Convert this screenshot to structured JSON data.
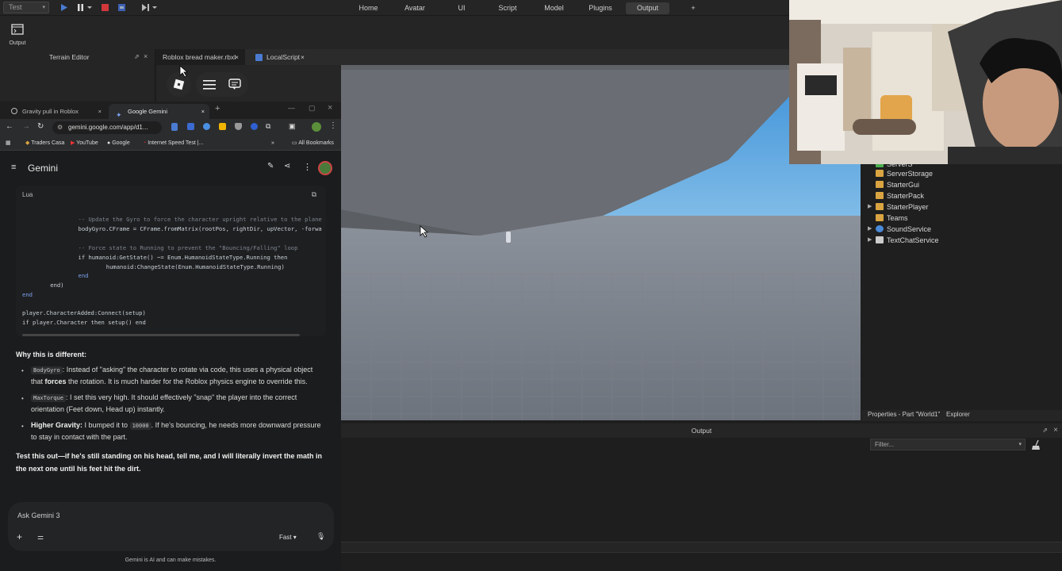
{
  "studio": {
    "mode": "Test",
    "menu_tabs": [
      "Home",
      "Avatar",
      "UI",
      "Script",
      "Model",
      "Plugins",
      "Output",
      "+"
    ],
    "active_tab": "Output",
    "output_tool_label": "Output",
    "terrain_editor": "Terrain Editor",
    "doc_tabs": [
      "Roblox bread maker.rbxl",
      "LocalScript"
    ],
    "explorer_items": [
      {
        "label": "ServerS",
        "icon_color": "#4caf50",
        "arrow": false
      },
      {
        "label": "ServerStorage",
        "icon_color": "#d9a441",
        "arrow": false
      },
      {
        "label": "StarterGui",
        "icon_color": "#d9a441",
        "arrow": false
      },
      {
        "label": "StarterPack",
        "icon_color": "#d9a441",
        "arrow": false
      },
      {
        "label": "StarterPlayer",
        "icon_color": "#d9a441",
        "arrow": true
      },
      {
        "label": "Teams",
        "icon_color": "#d9a441",
        "arrow": false
      },
      {
        "label": "SoundService",
        "icon_color": "#4a8ad8",
        "arrow": true
      },
      {
        "label": "TextChatService",
        "icon_color": "#cccccc",
        "arrow": true
      }
    ],
    "footer_tabs": [
      "Properties - Part \"World1\"",
      "Explorer"
    ],
    "output_title": "Output",
    "filter_placeholder": "Filter..."
  },
  "browser": {
    "tabs": [
      "Gravity pull in Roblox",
      "Google Gemini"
    ],
    "url": "gemini.google.com/app/d1...",
    "bookmarks": [
      "Traders Casa",
      "YouTube",
      "Google",
      "Internet Speed Test |...",
      "All Bookmarks"
    ]
  },
  "gemini": {
    "title": "Gemini",
    "code_lang": "Lua",
    "code_lines": [
      {
        "indent": 10,
        "cls": "cmt",
        "text": "-- Update the Gyro to force the character upright relative to the plane"
      },
      {
        "indent": 10,
        "cls": "",
        "text": "bodyGyro.CFrame = CFrame.fromMatrix(rootPos, rightDir, upVector, -forwa"
      },
      {
        "indent": 0,
        "cls": "",
        "text": ""
      },
      {
        "indent": 10,
        "cls": "cmt",
        "text": "-- Force state to Running to prevent the \"Bouncing/Falling\" loop"
      },
      {
        "indent": 10,
        "cls": "",
        "text": "if humanoid:GetState() ~= Enum.HumanoidStateType.Running then"
      },
      {
        "indent": 15,
        "cls": "",
        "text": "humanoid:ChangeState(Enum.HumanoidStateType.Running)"
      },
      {
        "indent": 10,
        "cls": "kw",
        "text": "end"
      },
      {
        "indent": 5,
        "cls": "",
        "text": "end)"
      },
      {
        "indent": 0,
        "cls": "kw",
        "text": "end"
      },
      {
        "indent": 0,
        "cls": "",
        "text": ""
      },
      {
        "indent": 0,
        "cls": "",
        "text": "player.CharacterAdded:Connect(setup)"
      },
      {
        "indent": 0,
        "cls": "",
        "text": "if player.Character then setup() end"
      }
    ],
    "why_heading": "Why this is different:",
    "bullet1_code": "BodyGyro",
    "bullet1_text_a": ": Instead of \"asking\" the character to rotate via code, this uses a physical object",
    "bullet1_text_b_pre": "that ",
    "bullet1_bold": "forces",
    "bullet1_text_b_post": " the rotation. It is much harder for the Roblox physics engine to override this.",
    "bullet2_code": "MaxTorque",
    "bullet2_text_a": ": I set this very high. It should effectively \"snap\" the player into the correct",
    "bullet2_text_b": "orientation (Feet down, Head up) instantly.",
    "bullet3_bold": "Higher Gravity:",
    "bullet3_text_pre": " I bumped it to ",
    "bullet3_code": "10000",
    "bullet3_text_post": ". If he's bouncing, he needs more downward pressure",
    "bullet3_text_b": "to stay in contact with the part.",
    "closing_a": "Test this out—if he's still standing on his head, tell me, and I will literally invert the math in",
    "closing_b": "the next one until his feet hit the dirt.",
    "ask_placeholder": "Ask Gemini 3",
    "model_mode": "Fast",
    "disclaimer": "Gemini is AI and can make mistakes."
  }
}
